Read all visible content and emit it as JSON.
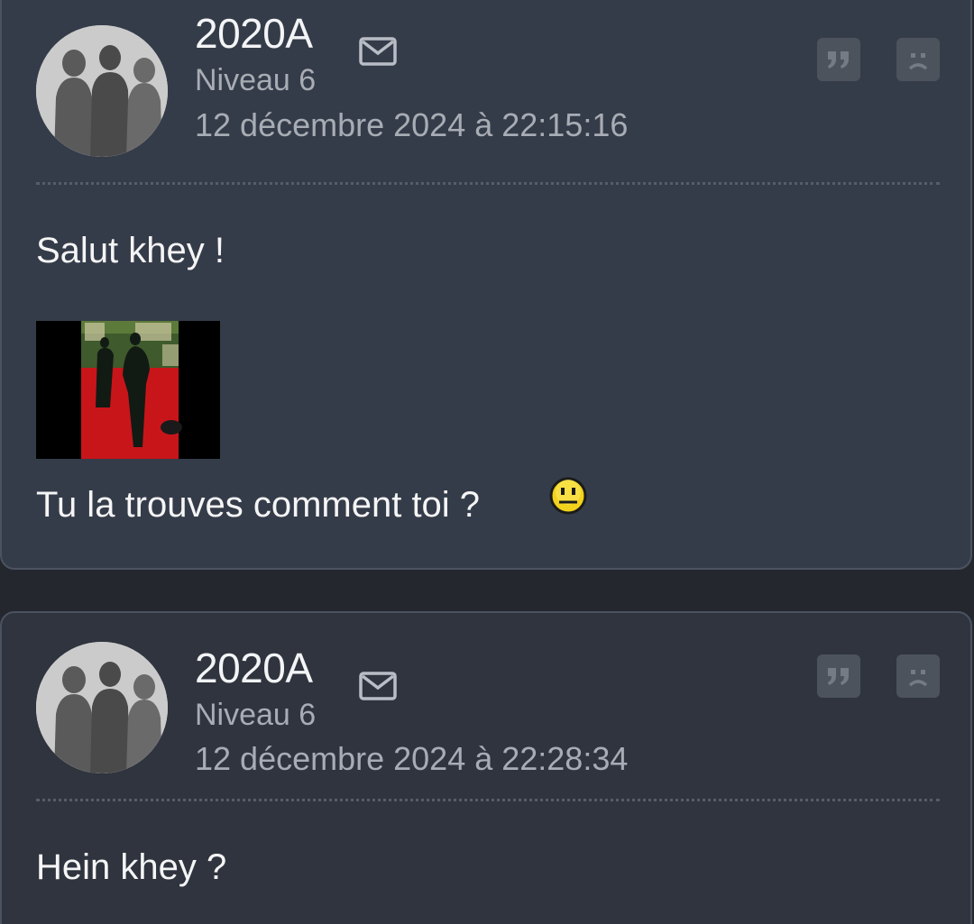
{
  "posts": [
    {
      "author": "2020A",
      "level": "Niveau 6",
      "date": "12 décembre 2024 à 22:15:16",
      "text_lines": [
        "Salut khey !",
        "Tu la trouves comment toi ?"
      ]
    },
    {
      "author": "2020A",
      "level": "Niveau 6",
      "date": "12 décembre 2024 à 22:28:34",
      "text_lines": [
        "Hein khey ?"
      ]
    }
  ],
  "icons": {
    "mail": "mail-icon",
    "quote": "quote-icon",
    "report": "sad-face-icon",
    "smiley": "neutral-smiley-icon"
  },
  "colors": {
    "page_background": "#24272d",
    "post_background": "#353c49",
    "button_background": "#4d535d",
    "secondary_text": "#a8acb4"
  }
}
